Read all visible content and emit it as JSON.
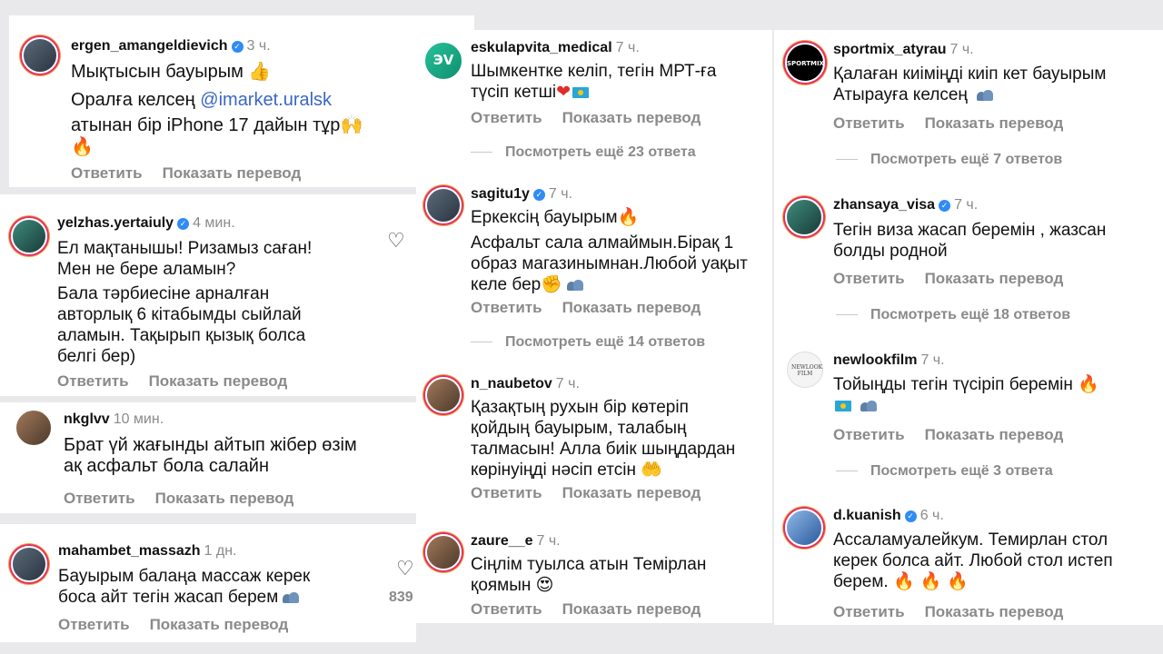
{
  "columns": [
    {
      "comments": [
        {
          "username": "ergen_amangeldievich",
          "verified": true,
          "time": "3 ч.",
          "lines": [
            "Мықтысын бауырым",
            "Оралға келсең",
            "атынан бір iPhone 17 дайын тұр"
          ],
          "mention": "@imarket.uralsk",
          "reply": "Ответить",
          "translate": "Показать перевод"
        },
        {
          "username": "yelzhas.yertaiuly",
          "verified": true,
          "time": "4 мин.",
          "lines": [
            "Ел мақтанышы! Ризамыз саған!",
            "Мен не бере аламын?",
            "Бала тәрбиесіне арналған",
            "авторлық 6 кітабымды сыйлай",
            "аламын. Тақырып қызық болса",
            "белгі бер)"
          ],
          "reply": "Ответить",
          "translate": "Показать перевод"
        },
        {
          "username": "nkglvv",
          "verified": false,
          "time": "10 мин.",
          "lines": [
            "Брат үй жағынды айтып жібер өзім",
            "ақ асфальт бола салайн"
          ],
          "reply": "Ответить",
          "translate": "Показать перевод"
        },
        {
          "username": "mahambet_massazh",
          "verified": false,
          "time": "1 дн.",
          "lines": [
            "Бауырым балаңа массаж керек",
            "боса айт тегін жасап берем"
          ],
          "likes": "839",
          "reply": "Ответить",
          "translate": "Показать перевод"
        }
      ]
    },
    {
      "comments": [
        {
          "username": "eskulapvita_medical",
          "verified": false,
          "time": "7 ч.",
          "lines": [
            "Шымкентке келіп, тегін МРТ-ға",
            "түсіп кетші"
          ],
          "reply": "Ответить",
          "translate": "Показать перевод",
          "more": "Посмотреть ещё 23 ответа"
        },
        {
          "username": "sagitu1y",
          "verified": true,
          "time": "7 ч.",
          "lines": [
            "Еркексің бауырым",
            "Асфальт сала алмаймын.Бірақ 1",
            "образ магазинымнан.Любой уақыт",
            "келе бер"
          ],
          "reply": "Ответить",
          "translate": "Показать перевод",
          "more": "Посмотреть ещё 14 ответов"
        },
        {
          "username": "n_naubetov",
          "verified": false,
          "time": "7 ч.",
          "lines": [
            "Қазақтың рухын бір көтеріп",
            "қойдың бауырым, талабың",
            "талмасын! Алла биік шыңдардан",
            "көрінуіңді нәсіп етсін"
          ],
          "reply": "Ответить",
          "translate": "Показать перевод"
        },
        {
          "username": "zaure__e",
          "verified": false,
          "time": "7 ч.",
          "lines": [
            "Сіңлім туылса атын Темірлан",
            "қоямын"
          ],
          "reply": "Ответить",
          "translate": "Показать перевод"
        }
      ]
    },
    {
      "comments": [
        {
          "username": "sportmix_atyrau",
          "verified": false,
          "time": "7 ч.",
          "lines": [
            "Қалаған киіміңді киіп кет бауырым",
            "Атырауға келсең"
          ],
          "reply": "Ответить",
          "translate": "Показать перевод",
          "more": "Посмотреть ещё 7 ответов"
        },
        {
          "username": "zhansaya_visa",
          "verified": true,
          "time": "7 ч.",
          "lines": [
            "Тегін виза жасап беремін , жазсан",
            "болды родной"
          ],
          "reply": "Ответить",
          "translate": "Показать перевод",
          "more": "Посмотреть ещё 18 ответов"
        },
        {
          "username": "newlookfilm",
          "verified": false,
          "time": "7 ч.",
          "lines": [
            "Тойыңды тегін түсіріп беремін"
          ],
          "reply": "Ответить",
          "translate": "Показать перевод",
          "more": "Посмотреть ещё 3 ответа"
        },
        {
          "username": "d.kuanish",
          "verified": true,
          "time": "6 ч.",
          "lines": [
            "Ассаламуалейкум. Темирлан стол",
            "керек болса айт. Любой стол истеп",
            "берем."
          ],
          "reply": "Ответить",
          "translate": "Показать перевод"
        }
      ]
    }
  ],
  "icons": {
    "like": "heart-outline-icon",
    "verified": "verified-badge-icon"
  },
  "colors": {
    "link": "#3a67c4",
    "meta": "#8a8a8a",
    "verified": "#2f8bf5"
  }
}
